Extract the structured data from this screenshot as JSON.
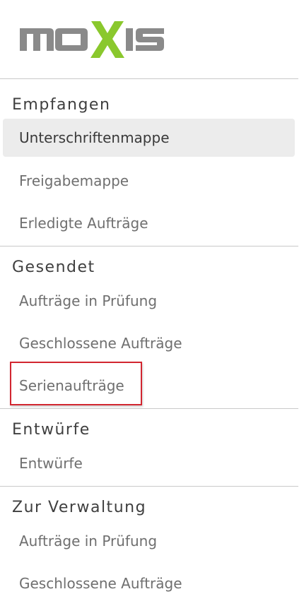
{
  "brand": {
    "logo_text": "MOXIS",
    "colors": {
      "gray": "#8a8a8a",
      "green": "#8ac82d"
    }
  },
  "sections": [
    {
      "title": "Empfangen",
      "items": [
        {
          "label": "Unterschriftenmappe",
          "active": true
        },
        {
          "label": "Freigabemappe"
        },
        {
          "label": "Erledigte Aufträge"
        }
      ]
    },
    {
      "title": "Gesendet",
      "items": [
        {
          "label": "Aufträge in Prüfung"
        },
        {
          "label": "Geschlossene Aufträge"
        },
        {
          "label": "Serienaufträge",
          "highlighted": true
        }
      ]
    },
    {
      "title": "Entwürfe",
      "items": [
        {
          "label": "Entwürfe"
        }
      ]
    },
    {
      "title": "Zur Verwaltung",
      "items": [
        {
          "label": "Aufträge in Prüfung"
        },
        {
          "label": "Geschlossene Aufträge"
        }
      ]
    }
  ],
  "highlight_color": "#d22630"
}
